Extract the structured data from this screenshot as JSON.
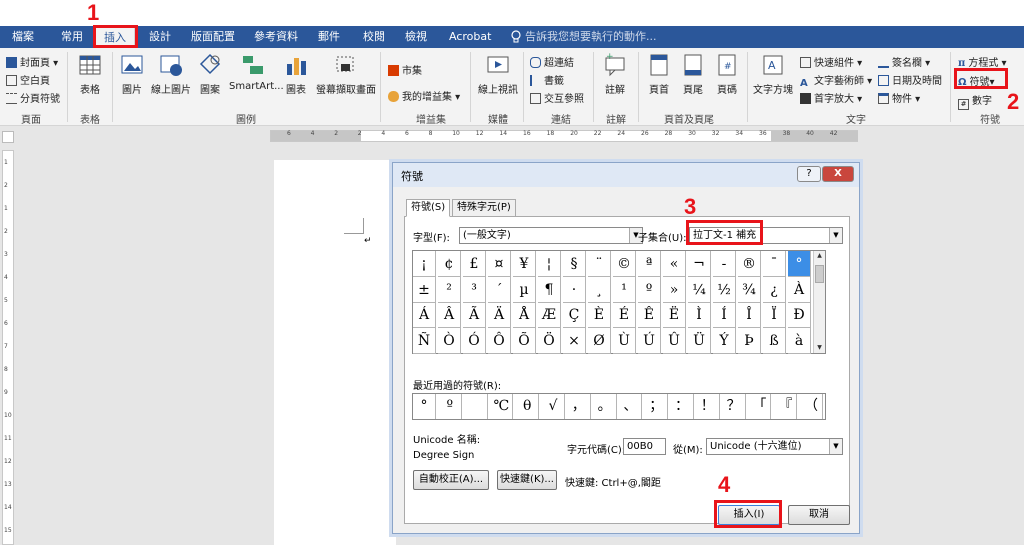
{
  "tabs": [
    "檔案",
    "常用",
    "插入",
    "設計",
    "版面配置",
    "參考資料",
    "郵件",
    "校閱",
    "檢視",
    "Acrobat"
  ],
  "tell_me": "告訴我您想要執行的動作...",
  "ribbon": {
    "pages": {
      "cover": "封面頁",
      "blank": "空白頁",
      "break": "分頁符號",
      "label": "頁面"
    },
    "tables": {
      "table": "表格",
      "label": "表格"
    },
    "illustrations": {
      "picture": "圖片",
      "online_picture": "線上圖片",
      "shapes": "圖案",
      "smartart": "SmartArt...",
      "chart": "圖表",
      "screenshot": "螢幕擷取畫面",
      "label": "圖例"
    },
    "addins": {
      "store": "市集",
      "my_addins": "我的增益集",
      "label": "增益集"
    },
    "media": {
      "online_video": "線上視訊",
      "label": "媒體"
    },
    "links": {
      "hyperlink": "超連結",
      "bookmark": "書籤",
      "cross_ref": "交互參照",
      "label": "連結"
    },
    "comments": {
      "comment": "註解",
      "label": "註解"
    },
    "header_footer": {
      "header": "頁首",
      "footer": "頁尾",
      "page_number": "頁碼",
      "label": "頁首及頁尾"
    },
    "text": {
      "textbox": "文字方塊",
      "quick_parts": "快速組件",
      "wordart": "文字藝術師",
      "drop_cap": "首字放大",
      "signature": "簽名欄",
      "datetime": "日期及時間",
      "object": "物件",
      "label": "文字"
    },
    "symbols": {
      "equation": "方程式",
      "symbol": "符號",
      "number": "數字",
      "label": "符號"
    }
  },
  "ruler_numbers": [
    "6",
    "4",
    "2",
    "2",
    "4",
    "6",
    "8",
    "10",
    "12",
    "14",
    "16",
    "18",
    "20",
    "22",
    "24",
    "26",
    "28",
    "30",
    "32",
    "34",
    "36",
    "38",
    "40",
    "42"
  ],
  "vruler_numbers": [
    "1",
    "2",
    "1",
    "2",
    "3",
    "4",
    "5",
    "6",
    "7",
    "8",
    "9",
    "10",
    "11",
    "12",
    "13",
    "14",
    "15",
    "16"
  ],
  "dialog": {
    "title": "符號",
    "help": "?",
    "close": "X",
    "tab_symbols": "符號(S)",
    "tab_special": "特殊字元(P)",
    "font_label": "字型(F):",
    "font_value": "(一般文字)",
    "subset_label": "子集合(U):",
    "subset_value": "拉丁文-1 補充",
    "grid": [
      [
        "¡",
        "¢",
        "£",
        "¤",
        "¥",
        "¦",
        "§",
        "¨",
        "©",
        "ª",
        "«",
        "¬",
        "-",
        "®",
        "¯",
        "°"
      ],
      [
        "±",
        "²",
        "³",
        "´",
        "µ",
        "¶",
        "·",
        "¸",
        "¹",
        "º",
        "»",
        "¼",
        "½",
        "¾",
        "¿",
        "À"
      ],
      [
        "Á",
        "Â",
        "Ã",
        "Ä",
        "Å",
        "Æ",
        "Ç",
        "È",
        "É",
        "Ê",
        "Ë",
        "Ì",
        "Í",
        "Î",
        "Ï",
        "Ð"
      ],
      [
        "Ñ",
        "Ò",
        "Ó",
        "Ô",
        "Õ",
        "Ö",
        "×",
        "Ø",
        "Ù",
        "Ú",
        "Û",
        "Ü",
        "Ý",
        "Þ",
        "ß",
        "à"
      ]
    ],
    "recent_label": "最近用過的符號(R):",
    "recent": [
      "°",
      "º",
      "",
      "℃",
      "θ",
      "√",
      "，",
      "。",
      "、",
      "；",
      "：",
      "！",
      "？",
      "「",
      "『",
      "（"
    ],
    "unicode_name_label": "Unicode 名稱:",
    "unicode_name": "Degree Sign",
    "char_code_label": "字元代碼(C):",
    "char_code": "00B0",
    "from_label": "從(M):",
    "from_value": "Unicode (十六進位)",
    "autocorrect": "自動校正(A)...",
    "shortcut_key": "快速鍵(K)...",
    "shortcut_text": "快速鍵: Ctrl+@,閣距",
    "insert": "插入(I)",
    "cancel": "取消"
  },
  "callouts": [
    "1",
    "2",
    "3",
    "4"
  ],
  "colors": {
    "accent": "#2b579a",
    "callout": "#e8141a",
    "selected": "#3c8ee6"
  }
}
